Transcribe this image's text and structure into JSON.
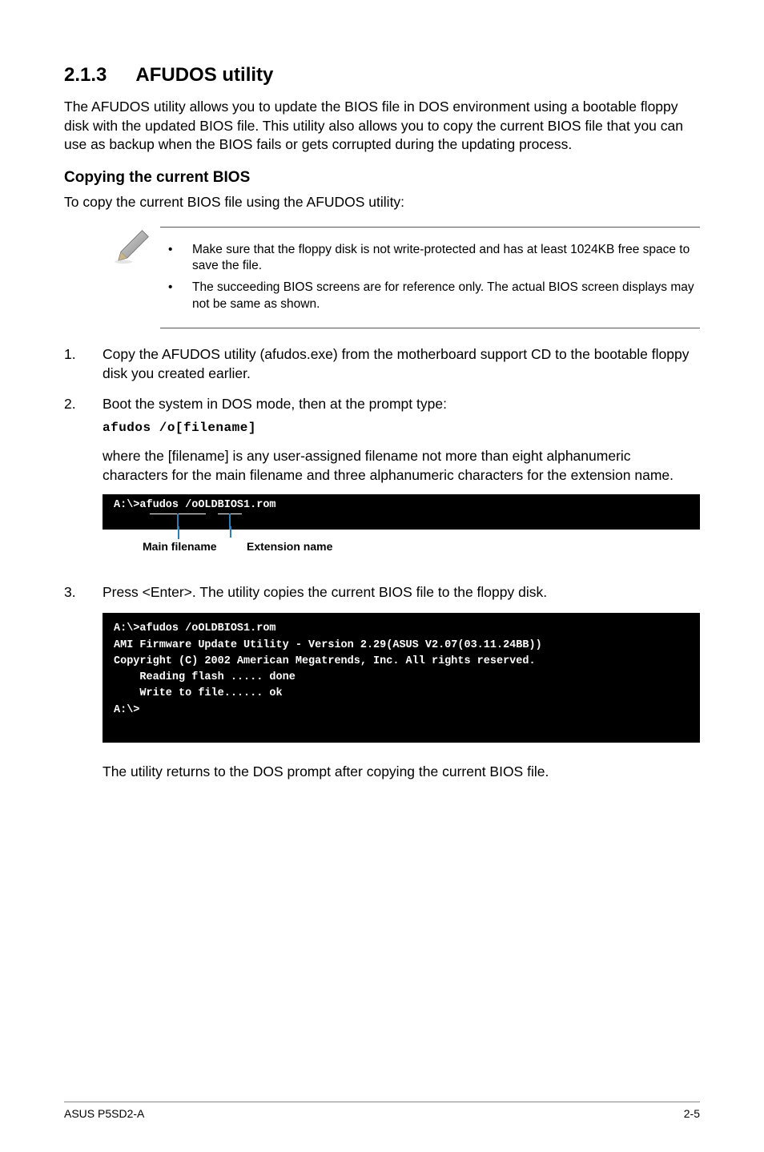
{
  "section": {
    "number": "2.1.3",
    "title": "AFUDOS utility",
    "intro": "The AFUDOS utility allows you to update the BIOS file in DOS environment using a bootable floppy disk with the updated BIOS file. This utility also allows you to copy the current BIOS file that you can use as backup when the BIOS fails or gets corrupted during the updating process."
  },
  "copying": {
    "heading": "Copying the current BIOS",
    "lead": "To copy the current BIOS file using the AFUDOS utility:"
  },
  "notes": [
    "Make sure that the floppy disk is not write-protected and has at least 1024KB free space to save the file.",
    "The succeeding BIOS screens are for reference only. The actual BIOS screen displays may not be same as shown."
  ],
  "steps": {
    "s1": "Copy the AFUDOS utility (afudos.exe) from the motherboard support CD to the bootable floppy disk you created earlier.",
    "s2_a": "Boot the system in DOS mode, then at the prompt type:",
    "s2_cmd": "afudos /o[filename]",
    "s2_b": "where the [filename] is any user-assigned filename not more than eight alphanumeric characters  for the main filename and three alphanumeric characters for the extension name.",
    "s3": "Press <Enter>. The utility copies the current BIOS file to the floppy disk."
  },
  "terminal1": "A:\\>afudos /oOLDBIOS1.rom",
  "diagram": {
    "main": "Main filename",
    "ext": "Extension name"
  },
  "terminal2": "A:\\>afudos /oOLDBIOS1.rom\nAMI Firmware Update Utility - Version 2.29(ASUS V2.07(03.11.24BB))\nCopyright (C) 2002 American Megatrends, Inc. All rights reserved.\n    Reading flash ..... done\n    Write to file...... ok\nA:\\>\n ",
  "closing": "The utility returns to the DOS prompt after copying the current BIOS file.",
  "footer": {
    "left": "ASUS P5SD2-A",
    "right": "2-5"
  }
}
